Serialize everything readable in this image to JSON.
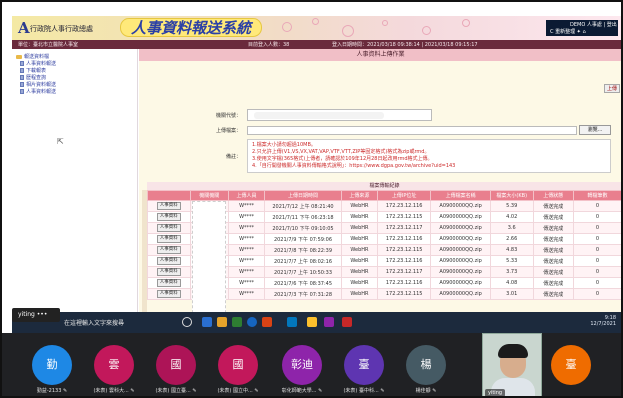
{
  "app": {
    "agency": "行政院人事行政總處",
    "title": "人事資料報送系統",
    "topright_line1": "DEMO 人事處 | 登出",
    "topright_line2": "C 重新整理   ✦  ⌂"
  },
  "userbar": {
    "left": "單位：臺北市立醫院人事室",
    "center": "目前登入人數：38",
    "right": "登入日期時間：2021/03/18 09:38:14 | 2021/03/18 09:15:17"
  },
  "sidebar": {
    "items": [
      {
        "label": "報送資料檔"
      },
      {
        "label": "人事資料報送"
      },
      {
        "label": "下載報表"
      },
      {
        "label": "歷程查詢"
      },
      {
        "label": "相片資料報送"
      },
      {
        "label": "人事資料報送"
      }
    ]
  },
  "main": {
    "page_title": "人事資料上傳作業",
    "upload_button": "上傳",
    "field1_label": "機關代號：",
    "field2_label": "上傳檔案：",
    "browse_button": "瀏覽...",
    "notes_label": "備註：",
    "notes": [
      "1.檔案大小請勿超過10MB。",
      "2.只允許上傳(V1,VS,VX,VAT,VAP,VTF,VTT,ZIP等固定格式)格式為zip或rmd。",
      "3.使用文字檔(365格式)上傳者，請確認於109年12月28日起改用rmd格式上傳。",
      "4.「自行開發機關人事資料傳輸格式說明」：https://www.dgpa.gov.tw/archive?uid=143"
    ]
  },
  "table": {
    "title": "檔案傳輸紀錄",
    "headers": [
      "",
      "機關機關",
      "上傳人員",
      "上傳日期時間",
      "上傳來源",
      "上傳IP位址",
      "上傳檔案名稱",
      "檔案大小(KB)",
      "上傳狀態",
      "轉檔筆數"
    ],
    "rows": [
      {
        "btn": "人事資料",
        "user": "W****",
        "time": "2021/7/12 上午 08:21:40",
        "src": "WebHR",
        "ip": "172.23.12.116",
        "file": "A0900000QQ.zip",
        "size": "5.39",
        "status": "傳送完成",
        "count": "0"
      },
      {
        "btn": "人事資料",
        "user": "W****",
        "time": "2021/7/11 下午 06:23:18",
        "src": "WebHR",
        "ip": "172.23.12.115",
        "file": "A0900000QQ.zip",
        "size": "4.02",
        "status": "傳送完成",
        "count": "0"
      },
      {
        "btn": "人事資料",
        "user": "W****",
        "time": "2021/7/10 下午 09:10:05",
        "src": "WebHR",
        "ip": "172.23.12.117",
        "file": "A0900000QQ.zip",
        "size": "3.6",
        "status": "傳送完成",
        "count": "0"
      },
      {
        "btn": "人事資料",
        "user": "W****",
        "time": "2021/7/9 下午 07:59:06",
        "src": "WebHR",
        "ip": "172.23.12.116",
        "file": "A0900000QQ.zip",
        "size": "2.66",
        "status": "傳送完成",
        "count": "0"
      },
      {
        "btn": "人事資料",
        "user": "W****",
        "time": "2021/7/8 下午 08:22:39",
        "src": "WebHR",
        "ip": "172.23.12.115",
        "file": "A0900000QQ.zip",
        "size": "4.83",
        "status": "傳送完成",
        "count": "0"
      },
      {
        "btn": "人事資料",
        "user": "W****",
        "time": "2021/7/7 上午 08:02:16",
        "src": "WebHR",
        "ip": "172.23.12.116",
        "file": "A0900000QQ.zip",
        "size": "5.33",
        "status": "傳送完成",
        "count": "0"
      },
      {
        "btn": "人事資料",
        "user": "W****",
        "time": "2021/7/7 上午 10:50:33",
        "src": "WebHR",
        "ip": "172.23.12.117",
        "file": "A0900000QQ.zip",
        "size": "3.73",
        "status": "傳送完成",
        "count": "0"
      },
      {
        "btn": "人事資料",
        "user": "W****",
        "time": "2021/7/6 下午 08:37:45",
        "src": "WebHR",
        "ip": "172.23.12.116",
        "file": "A0900000QQ.zip",
        "size": "4.08",
        "status": "傳送完成",
        "count": "0"
      },
      {
        "btn": "人事資料",
        "user": "W****",
        "time": "2021/7/3 下午 07:31:28",
        "src": "WebHR",
        "ip": "172.23.12.115",
        "file": "A0900000QQ.zip",
        "size": "3.01",
        "status": "傳送完成",
        "count": "0"
      }
    ]
  },
  "taskbar": {
    "yiting_tag": "yiting  •••",
    "search_text": "在這裡輸入文字來搜尋",
    "time": "9:18",
    "date": "12/7/2021"
  },
  "meeting": {
    "participants": [
      {
        "initial": "勤",
        "name": "勤益-2133 ✎",
        "color": "#1e88e5"
      },
      {
        "initial": "雲",
        "name": "(未表) 雲科大... ✎",
        "color": "#c2185b"
      },
      {
        "initial": "國",
        "name": "(未表) 國立臺... ✎",
        "color": "#ad1457"
      },
      {
        "initial": "國",
        "name": "(未表) 國立中... ✎",
        "color": "#c2185b"
      },
      {
        "initial": "彰迪",
        "name": "彰化師範大學... ✎",
        "color": "#8e24aa"
      },
      {
        "initial": "臺",
        "name": "(未表) 臺中科... ✎",
        "color": "#5e35b1"
      },
      {
        "initial": "楊",
        "name": "楊佳靜 ✎",
        "color": "#455a64"
      },
      {
        "initial": "臺",
        "name": "",
        "color": "#ef6c00"
      }
    ],
    "video_name": "yiting"
  }
}
